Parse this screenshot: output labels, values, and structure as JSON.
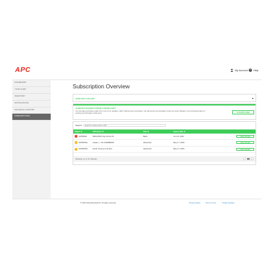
{
  "header": {
    "logo": "APC",
    "account_label": "My Account",
    "help_label": "Help"
  },
  "sidebar": {
    "items": [
      {
        "label": "Dashboard",
        "active": false
      },
      {
        "label": "Your Fleet",
        "active": false
      },
      {
        "label": "Inventory",
        "active": false
      },
      {
        "label": "Notifications",
        "active": false
      },
      {
        "label": "Technical Support",
        "active": false
      },
      {
        "label": "Subscriptions",
        "active": true
      }
    ]
  },
  "main": {
    "title": "Subscription Overview",
    "accordion_title": "JUST BUY A PLAN?",
    "promo": {
      "title": "ALREADY BOUGHT FROM A RESELLER?",
      "text": "You can also purchase a plan from one of our resellers. After ordering your purchases, you will receive an Activation Code via email. Redeem your purchased plan by entering the Activation Code here.",
      "button_label": "ACTIVATE CODE"
    },
    "search": {
      "label": "Search",
      "placeholder": "Search by device name or SN..."
    },
    "table": {
      "headers": [
        "Status ⇅",
        "UPS Name ⇅",
        "Plan ⇅",
        "Expiry Date ⇅",
        ""
      ],
      "rows": [
        {
          "status": "EXPIRED",
          "status_color": "#e8281e",
          "name": "SMC1000C Day Ghost #1",
          "plan": "Basic",
          "expiry": "Jun 10, 2022",
          "action": "VIEW OPTIONS"
        },
        {
          "status": "EXPIRING",
          "status_color": "#f5b400",
          "name": "Castle 1 - SN 16SMB0022",
          "plan": "Advanced",
          "expiry": "May 17, 2023",
          "action": "VIEW OPTIONS"
        },
        {
          "status": "EXPIRING",
          "status_color": "#f5b400",
          "name": "South Campus 2nd floor",
          "plan": "Advanced",
          "expiry": "May 17, 2023",
          "action": "VIEW OPTIONS"
        }
      ],
      "showing_text": "Showing 1 to 3 of 3 Results",
      "pages": [
        "‹",
        "1",
        "›"
      ]
    }
  },
  "footer": {
    "copyright": "© 2023 Schneider Electric. All rights reserved.",
    "links": [
      "Privacy Notice",
      "Terms of Use",
      "Cookie Settings"
    ]
  },
  "colors": {
    "accent": "#3dcd58",
    "brand": "#e8281e",
    "warning": "#f5b400"
  }
}
